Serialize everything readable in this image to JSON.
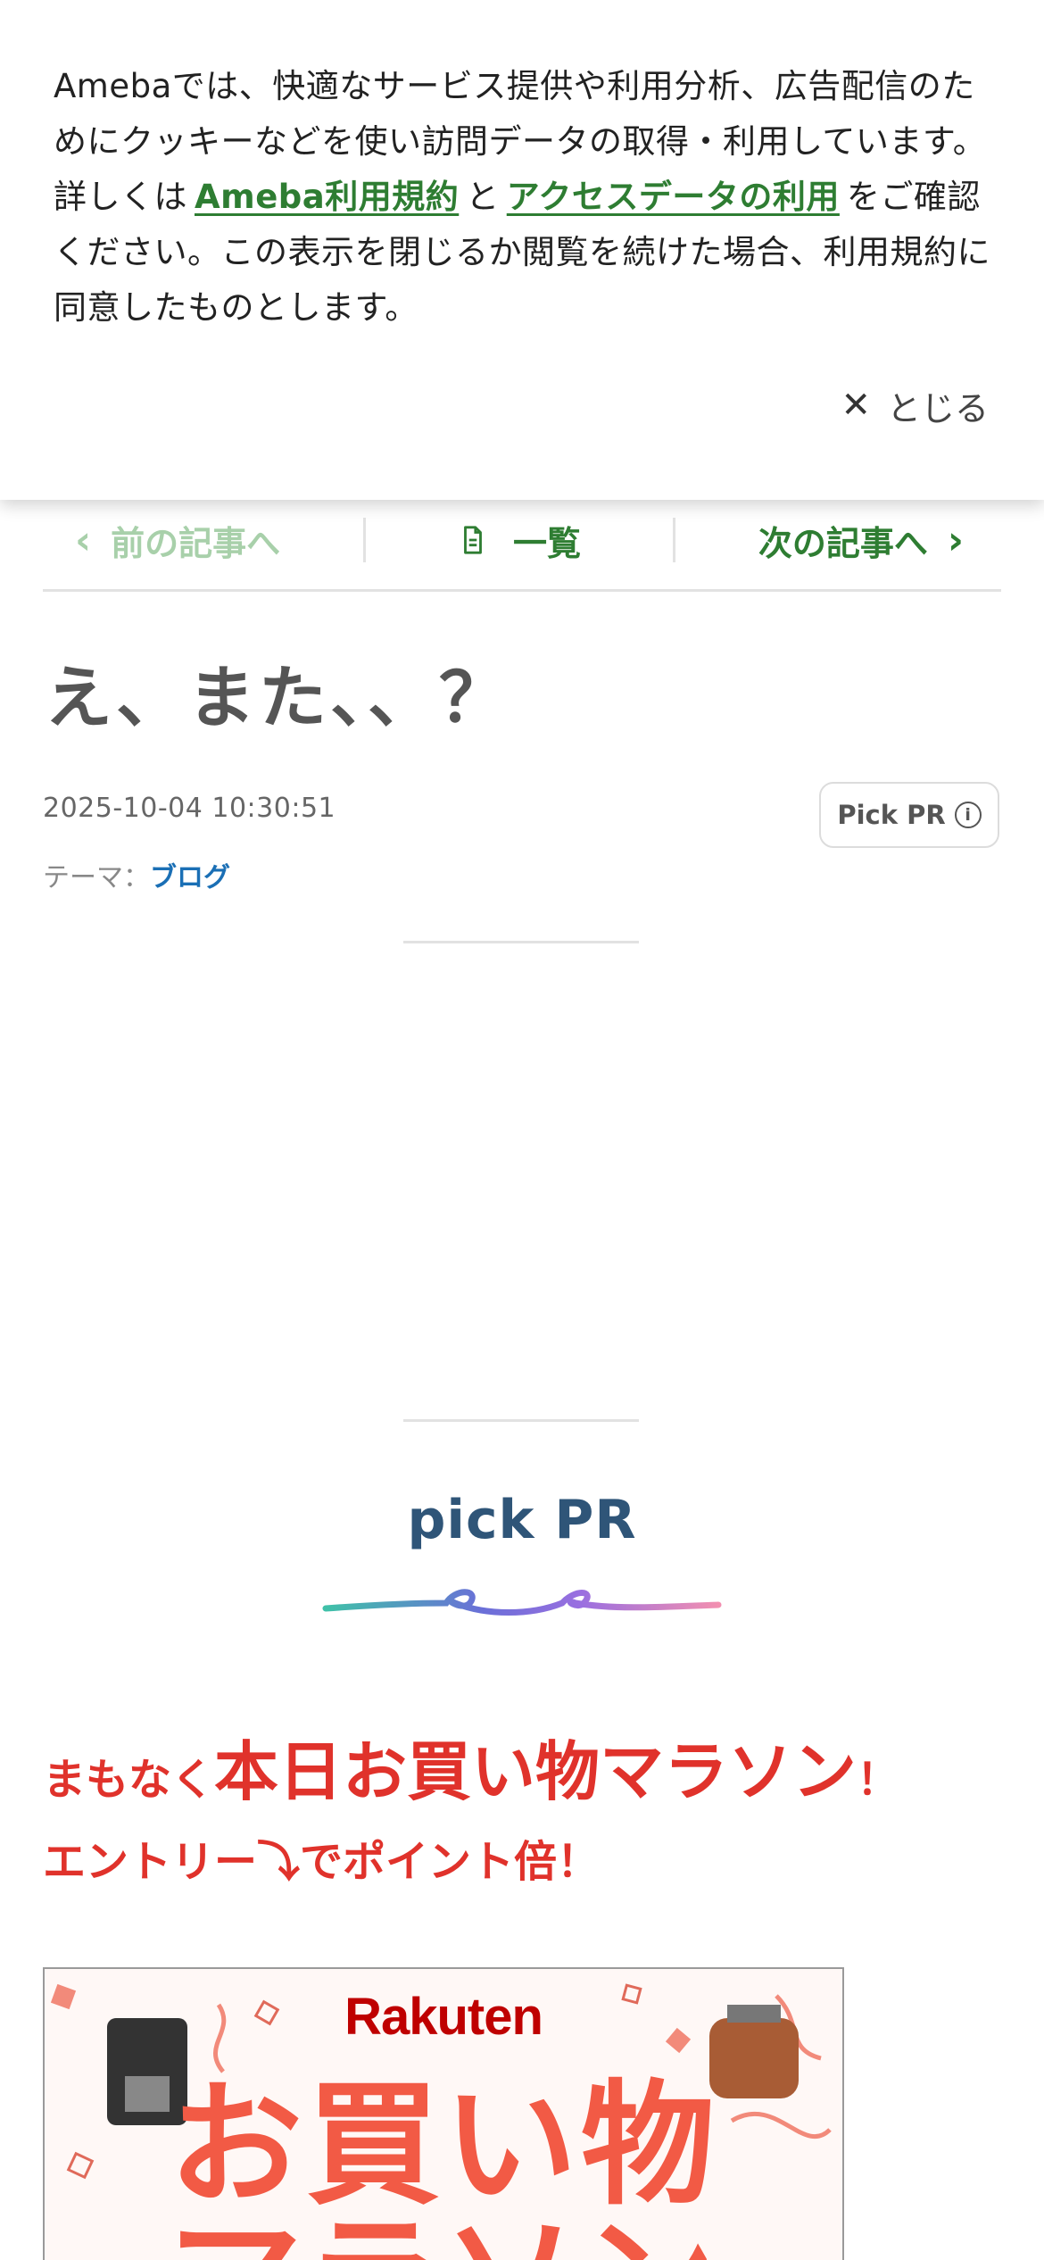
{
  "cookie": {
    "text_1": "Amebaでは、快適なサービス提供や利用分析、広告配信のためにクッキーなどを使い訪問データの取得・利用しています。詳しくは",
    "link_terms": "Ameba利用規約",
    "text_and": "と",
    "link_access": "アクセスデータの利用",
    "text_2": "をご確認ください。この表示を閉じるか閲覧を続けた場合、利用規約に同意したものとします。",
    "close_label": "とじる",
    "close_glyph": "✕"
  },
  "nav": {
    "prev_label": "前の記事へ",
    "list_label": "一覧",
    "next_label": "次の記事へ",
    "prev_glyph": "‹",
    "next_glyph": "›"
  },
  "article": {
    "title": "え、また、、？",
    "datetime": "2025-10-04 10:30:51",
    "theme_label": "テーマ：",
    "theme_value": "ブログ",
    "pickpr_label": "Pick PR",
    "info_glyph": "i"
  },
  "pick_pr": {
    "heading": "pick PR",
    "promo_small_1": "まもなく",
    "promo_big": "本日お買い物マラソン",
    "promo_small_2": "！",
    "promo_line2": "エントリー⤵でポイント倍！",
    "banner_logo": "Rakuten",
    "banner_line1": "お買い物",
    "banner_line2": "マラソン"
  },
  "colors": {
    "accent_green": "#2e7d32",
    "promo_red": "#e0322b",
    "link_blue": "#1a6fb5",
    "pick_heading": "#2f5578"
  },
  "icons": {
    "close": "close-icon",
    "prev": "chevron-left-icon",
    "next": "chevron-right-icon",
    "list": "document-icon",
    "info": "info-icon"
  }
}
